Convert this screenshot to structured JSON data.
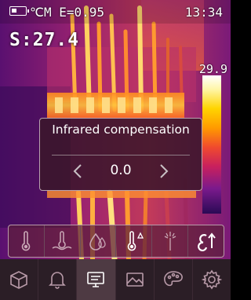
{
  "status": {
    "mode_line": "℃M E=0.95",
    "time": "13:34",
    "battery_level": 0.4
  },
  "spot_reading": "S:27.4",
  "scale": {
    "max": "29.9"
  },
  "dialog": {
    "title": "Infrared compensation",
    "value": "0.0",
    "prev_icon": "chevron-left-icon",
    "next_icon": "chevron-right-icon"
  },
  "function_bar": {
    "items": [
      {
        "icon": "thermometer-icon"
      },
      {
        "icon": "ambient-temperature-icon"
      },
      {
        "icon": "humidity-icon"
      },
      {
        "icon": "thermometer-delta-icon",
        "selected": true
      },
      {
        "icon": "infrared-sensor-icon"
      },
      {
        "icon": "emissivity-icon"
      }
    ]
  },
  "menu": {
    "items": [
      {
        "icon": "box-icon"
      },
      {
        "icon": "bell-icon"
      },
      {
        "icon": "monitor-icon",
        "active": true
      },
      {
        "icon": "image-icon"
      },
      {
        "icon": "palette-icon"
      },
      {
        "icon": "gear-icon"
      }
    ]
  },
  "colors": {
    "dialog_bg": "#3a162a",
    "menu_bg": "#2b1e26",
    "icon_color": "#b89aa8"
  }
}
